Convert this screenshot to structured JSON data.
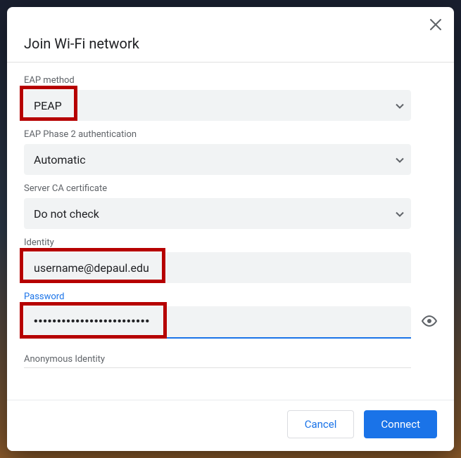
{
  "dialog": {
    "title": "Join Wi-Fi network",
    "close_icon": "close-icon"
  },
  "fields": {
    "eap_method": {
      "label": "EAP method",
      "value": "PEAP"
    },
    "eap_phase2": {
      "label": "EAP Phase 2 authentication",
      "value": "Automatic"
    },
    "server_ca": {
      "label": "Server CA certificate",
      "value": "Do not check"
    },
    "identity": {
      "label": "Identity",
      "value": "username@depaul.edu"
    },
    "password": {
      "label": "Password",
      "masked": "•••••••••••••••••••••••••"
    },
    "anonymous_identity": {
      "label": "Anonymous Identity"
    }
  },
  "buttons": {
    "cancel": "Cancel",
    "connect": "Connect"
  },
  "icons": {
    "chevron_down": "▼",
    "visibility": "eye-icon"
  },
  "colors": {
    "accent": "#1a73e8",
    "highlight_border": "#b60000",
    "text_primary": "#202124",
    "text_secondary": "#5f6368",
    "field_bg": "#f1f3f4"
  }
}
